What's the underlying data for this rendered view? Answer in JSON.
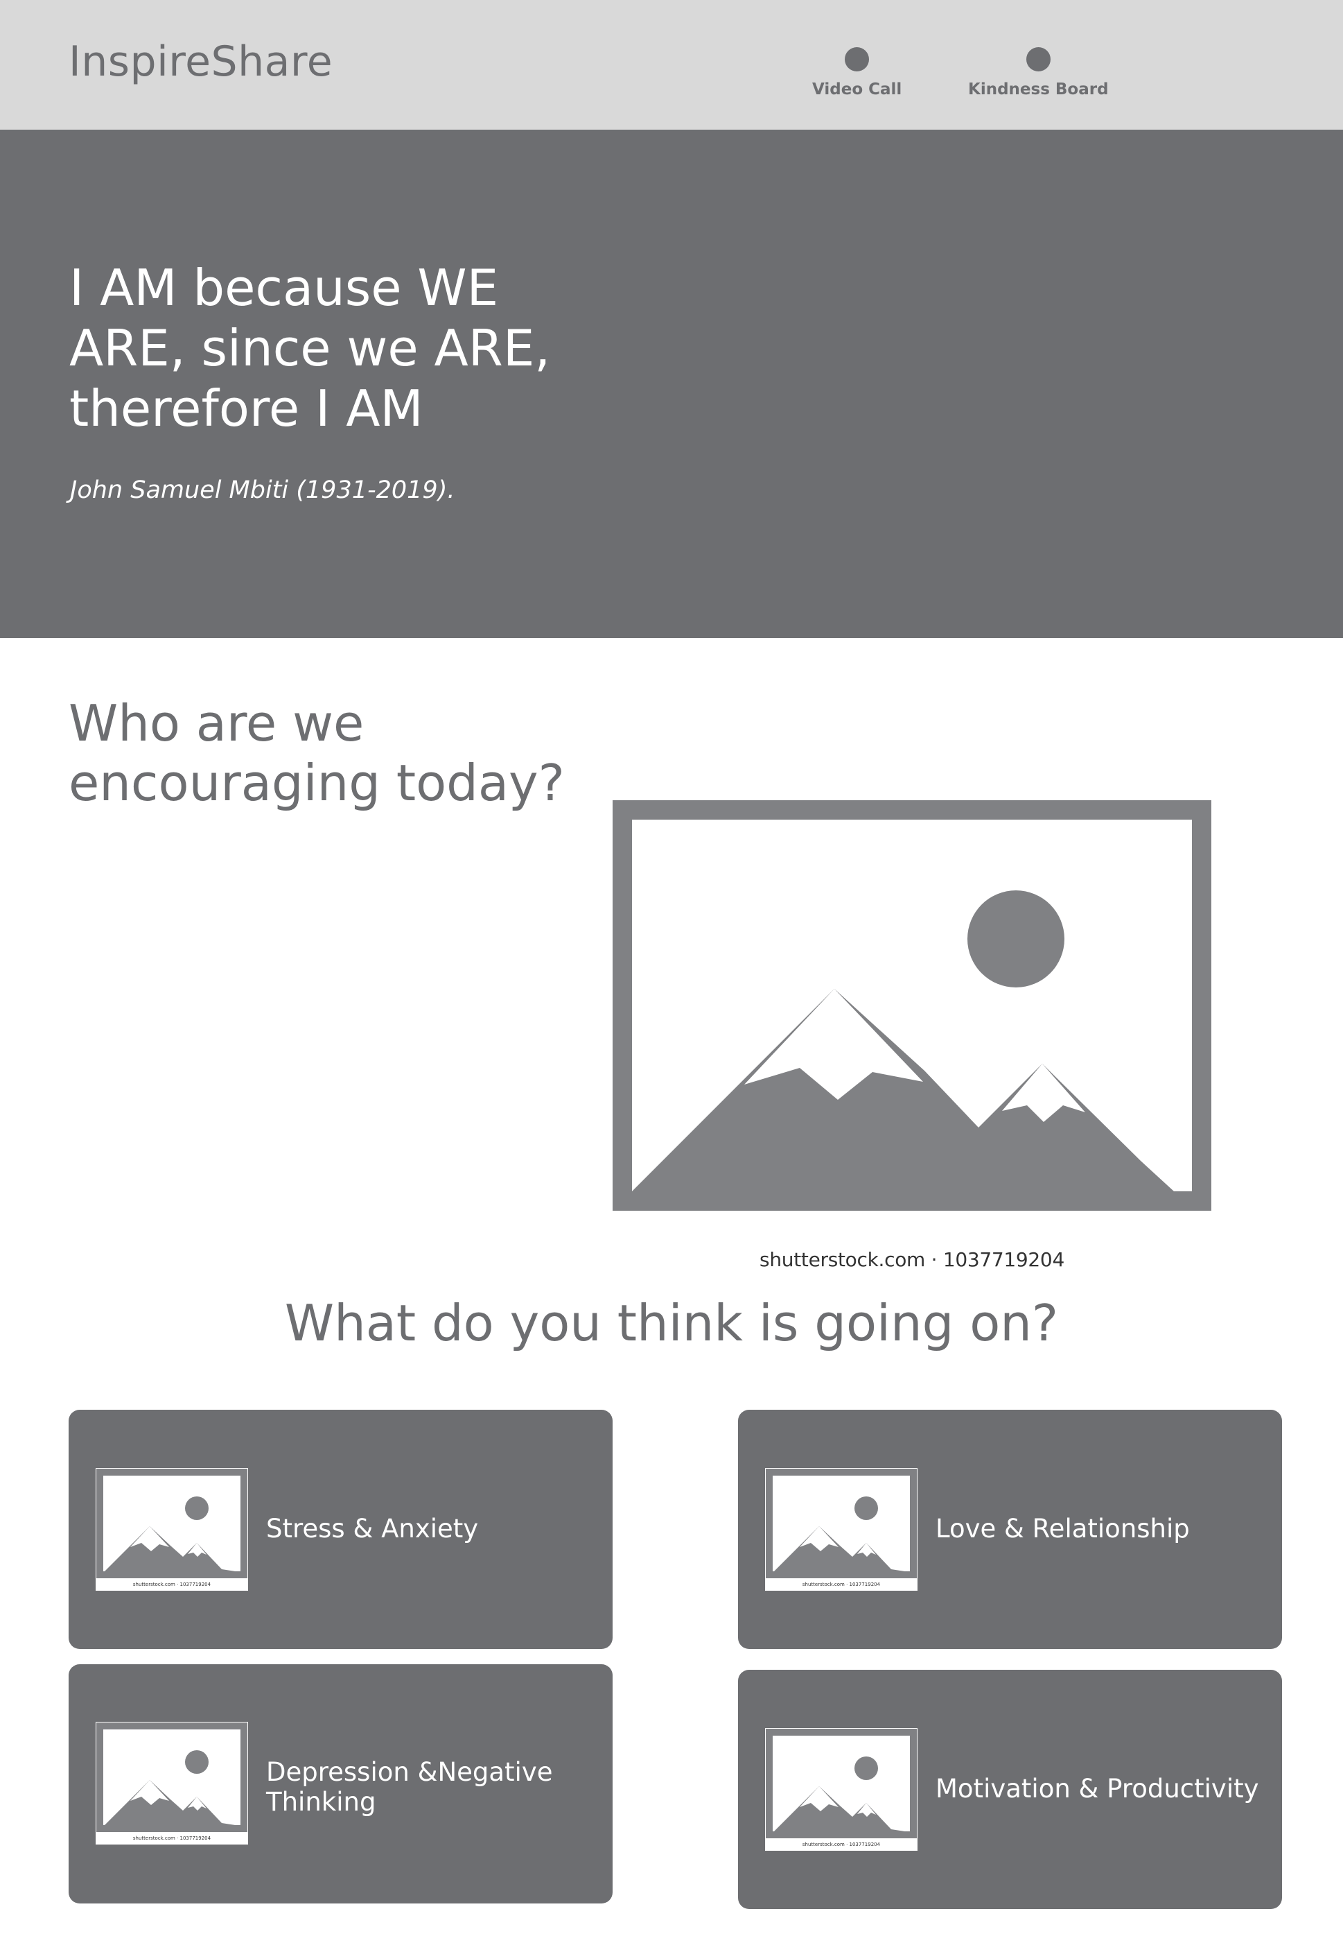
{
  "header": {
    "brand": "InspireShare",
    "nav": [
      {
        "label": "Video Call",
        "icon": "circle-icon"
      },
      {
        "label": "Kindness Board",
        "icon": "circle-icon"
      }
    ]
  },
  "hero": {
    "quote": "I AM because WE ARE, since we ARE, therefore I AM",
    "author": "John Samuel Mbiti (1931-2019)."
  },
  "who": {
    "heading": "Who are we encouraging today?",
    "image_caption": "shutterstock.com · 1037719204"
  },
  "topics": {
    "heading": "What do you think is going on?",
    "thumb_caption": "shutterstock.com · 1037719204",
    "cards": [
      {
        "label": "Stress & Anxiety"
      },
      {
        "label": "Love & Relationship"
      },
      {
        "label": "Depression &Negative Thinking"
      },
      {
        "label": "Motivation & Productivity"
      }
    ]
  },
  "colors": {
    "dark_gray": "#6d6e71",
    "light_gray": "#d9d9d9",
    "placeholder_gray": "#808184"
  }
}
